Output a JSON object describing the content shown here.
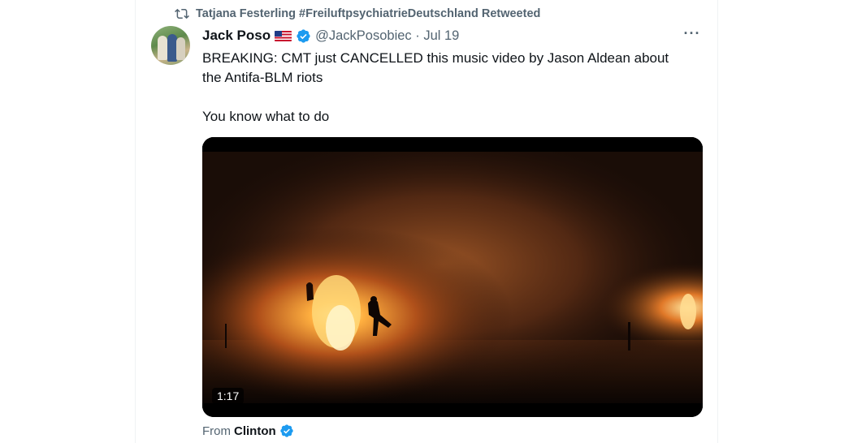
{
  "retweet": {
    "icon": "retweet-icon",
    "text": "Tatjana Festerling #FreiluftpsychiatrieDeutschland Retweeted"
  },
  "tweet": {
    "name": "Jack Poso",
    "flag": "us-flag-icon",
    "handle_date": "@JackPosobiec · Jul 19",
    "more_label": "···",
    "text": "BREAKING: CMT just CANCELLED this music video by Jason Aldean about\nthe Antifa-BLM riots\n\nYou know what to do",
    "video": {
      "duration": "1:17"
    },
    "from_prefix": "From",
    "from_source": "Clinton"
  },
  "colors": {
    "verified": "#1d9bf0",
    "secondary_text": "#536471",
    "primary_text": "#0f1419"
  }
}
